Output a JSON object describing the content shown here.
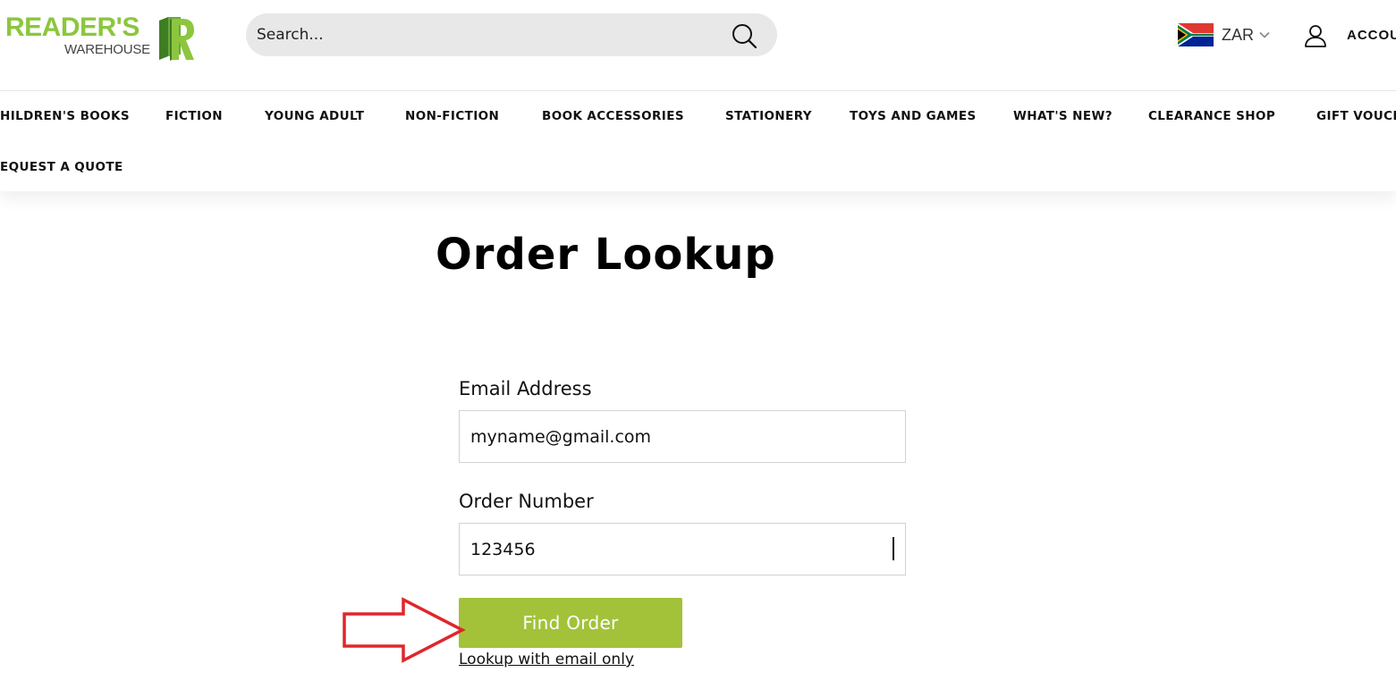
{
  "brand": {
    "name_top": "READER'S",
    "name_bottom": "WAREHOUSE",
    "logo_icon": "book-r-logo-icon",
    "green": "#8cc63f",
    "dark_green": "#4b8a2a"
  },
  "search": {
    "placeholder": "Search...",
    "icon": "search-icon"
  },
  "currency": {
    "code": "ZAR",
    "flag_icon": "south-africa-flag-icon"
  },
  "account": {
    "label": "ACCOU",
    "icon": "user-icon"
  },
  "nav": {
    "items": [
      "HILDREN'S BOOKS",
      "FICTION",
      "YOUNG ADULT",
      "NON-FICTION",
      "BOOK ACCESSORIES",
      "STATIONERY",
      "TOYS AND GAMES",
      "WHAT'S NEW?",
      "CLEARANCE SHOP",
      "GIFT VOUCH",
      "EQUEST A QUOTE"
    ]
  },
  "main": {
    "title": "Order Lookup",
    "email_label": "Email Address",
    "email_value": "myname@gmail.com",
    "order_label": "Order Number",
    "order_value": "123456",
    "button_label": "Find Order",
    "button_color": "#a3c23a",
    "alt_link": "Lookup with email only"
  },
  "annotation": {
    "arrow_color": "#e0262b",
    "icon": "red-arrow-right-icon"
  }
}
